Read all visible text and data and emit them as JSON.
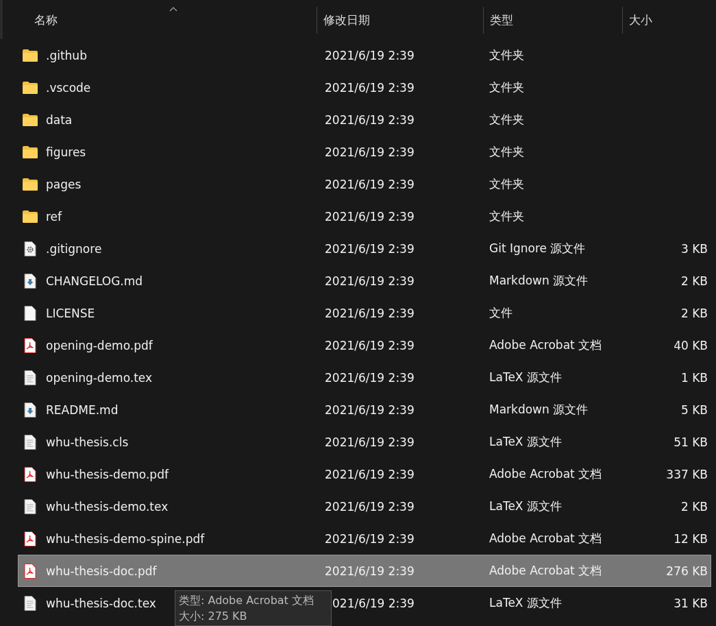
{
  "columns": [
    {
      "label": "名称",
      "sorted": true
    },
    {
      "label": "修改日期",
      "sorted": false
    },
    {
      "label": "类型",
      "sorted": false
    },
    {
      "label": "大小",
      "sorted": false
    }
  ],
  "files": [
    {
      "kind": "folder",
      "name": ".github",
      "date": "2021/6/19 2:39",
      "type": "文件夹",
      "selected": false
    },
    {
      "kind": "folder",
      "name": ".vscode",
      "date": "2021/6/19 2:39",
      "type": "文件夹",
      "selected": false
    },
    {
      "kind": "folder",
      "name": "data",
      "date": "2021/6/19 2:39",
      "type": "文件夹",
      "selected": false
    },
    {
      "kind": "folder",
      "name": "figures",
      "date": "2021/6/19 2:39",
      "type": "文件夹",
      "selected": false
    },
    {
      "kind": "folder",
      "name": "pages",
      "date": "2021/6/19 2:39",
      "type": "文件夹",
      "selected": false
    },
    {
      "kind": "folder",
      "name": "ref",
      "date": "2021/6/19 2:39",
      "type": "文件夹",
      "selected": false
    },
    {
      "kind": "config",
      "name": ".gitignore",
      "date": "2021/6/19 2:39",
      "type": "Git Ignore 源文件",
      "size": "3 KB",
      "selected": false
    },
    {
      "kind": "markdown",
      "name": "CHANGELOG.md",
      "date": "2021/6/19 2:39",
      "type": "Markdown 源文件",
      "size": "2 KB",
      "selected": false
    },
    {
      "kind": "blank",
      "name": "LICENSE",
      "date": "2021/6/19 2:39",
      "type": "文件",
      "size": "2 KB",
      "selected": false
    },
    {
      "kind": "pdf",
      "name": "opening-demo.pdf",
      "date": "2021/6/19 2:39",
      "type": "Adobe Acrobat 文档",
      "size": "40 KB",
      "selected": false
    },
    {
      "kind": "text",
      "name": "opening-demo.tex",
      "date": "2021/6/19 2:39",
      "type": "LaTeX 源文件",
      "size": "1 KB",
      "selected": false
    },
    {
      "kind": "markdown",
      "name": "README.md",
      "date": "2021/6/19 2:39",
      "type": "Markdown 源文件",
      "size": "5 KB",
      "selected": false
    },
    {
      "kind": "text",
      "name": "whu-thesis.cls",
      "date": "2021/6/19 2:39",
      "type": "LaTeX 源文件",
      "size": "51 KB",
      "selected": false
    },
    {
      "kind": "pdf",
      "name": "whu-thesis-demo.pdf",
      "date": "2021/6/19 2:39",
      "type": "Adobe Acrobat 文档",
      "size": "337 KB",
      "selected": false
    },
    {
      "kind": "text",
      "name": "whu-thesis-demo.tex",
      "date": "2021/6/19 2:39",
      "type": "LaTeX 源文件",
      "size": "2 KB",
      "selected": false
    },
    {
      "kind": "pdf",
      "name": "whu-thesis-demo-spine.pdf",
      "date": "2021/6/19 2:39",
      "type": "Adobe Acrobat 文档",
      "size": "12 KB",
      "selected": false
    },
    {
      "kind": "pdf",
      "name": "whu-thesis-doc.pdf",
      "date": "2021/6/19 2:39",
      "type": "Adobe Acrobat 文档",
      "size": "276 KB",
      "selected": true
    },
    {
      "kind": "text",
      "name": "whu-thesis-doc.tex",
      "date": "021/6/19 2:39",
      "date_partly_covered": true,
      "type": "LaTeX 源文件",
      "size": "31 KB",
      "selected": false
    }
  ],
  "tooltip": {
    "lines": [
      "类型: Adobe Acrobat 文档",
      "大小: 275 KB"
    ]
  }
}
